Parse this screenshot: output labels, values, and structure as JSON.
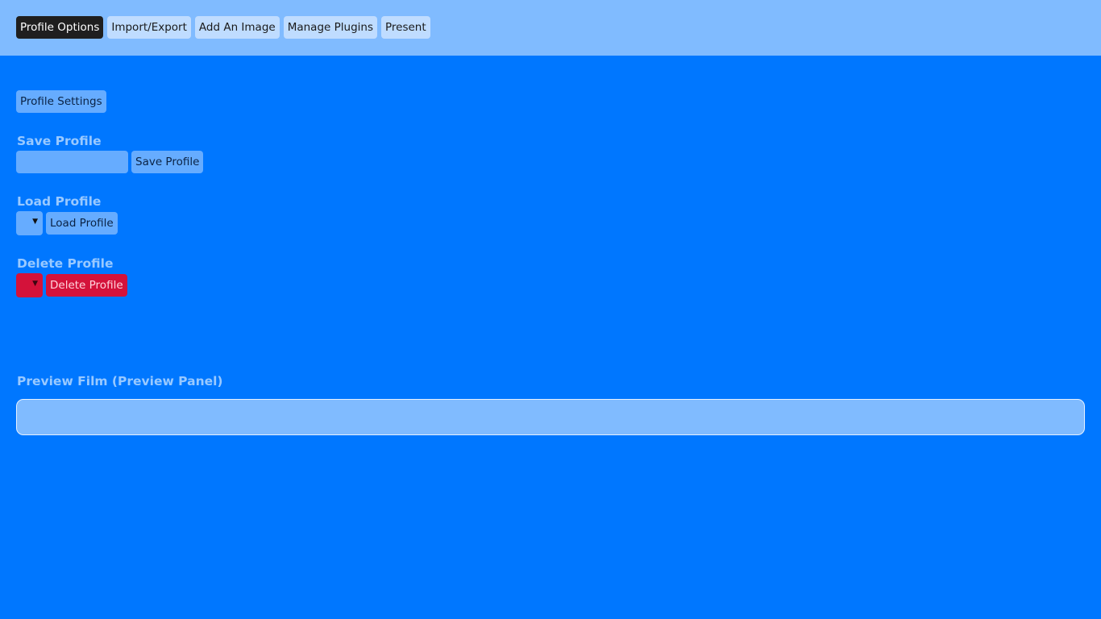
{
  "topbar": {
    "tabs": [
      {
        "label": "Profile Options",
        "active": true
      },
      {
        "label": "Import/Export",
        "active": false
      },
      {
        "label": "Add An Image",
        "active": false
      },
      {
        "label": "Manage Plugins",
        "active": false
      },
      {
        "label": "Present",
        "active": false
      }
    ]
  },
  "main": {
    "profile_settings_button": "Profile Settings",
    "save_section": {
      "heading": "Save Profile",
      "input_value": "",
      "button_label": "Save Profile"
    },
    "load_section": {
      "heading": "Load Profile",
      "selected_value": "",
      "button_label": "Load Profile"
    },
    "delete_section": {
      "heading": "Delete Profile",
      "selected_value": "",
      "button_label": "Delete Profile"
    },
    "preview": {
      "heading": "Preview Film (Preview Panel)"
    }
  },
  "icons": {
    "dropdown_caret": "▼"
  },
  "colors": {
    "page_background": "#0077ff",
    "topbar_background": "#80bbff",
    "active_tab": "#1f1f1f",
    "danger": "#d4123a"
  }
}
